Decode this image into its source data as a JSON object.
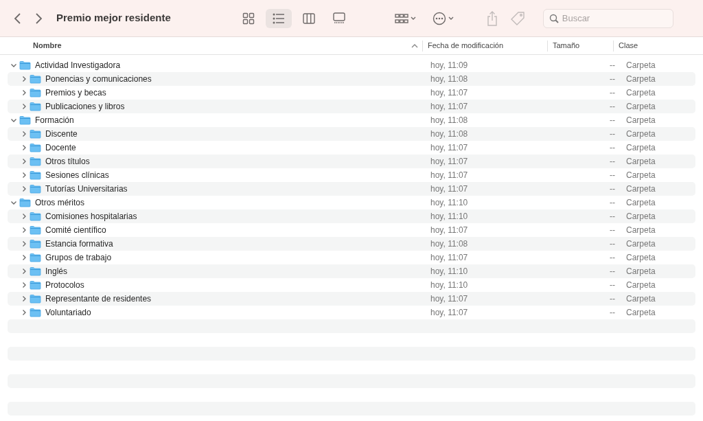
{
  "window": {
    "title": "Premio mejor residente"
  },
  "view_modes": [
    {
      "kind": "icons",
      "selected": false
    },
    {
      "kind": "list",
      "selected": true
    },
    {
      "kind": "columns",
      "selected": false
    },
    {
      "kind": "gallery",
      "selected": false
    }
  ],
  "search": {
    "placeholder": "Buscar"
  },
  "table": {
    "columns": [
      {
        "label": "Nombre",
        "sorted": true
      },
      {
        "label": "Fecha de modificación",
        "sorted": false
      },
      {
        "label": "Tamaño",
        "sorted": false
      },
      {
        "label": "Clase",
        "sorted": false
      }
    ],
    "rows": [
      {
        "name": "Actividad Investigadora",
        "date": "hoy, 11:09",
        "size": "--",
        "kind": "Carpeta",
        "expanded": true,
        "children": [
          {
            "name": "Ponencias y comunicaciones",
            "date": "hoy, 11:08",
            "size": "--",
            "kind": "Carpeta",
            "expanded": false
          },
          {
            "name": "Premios y becas",
            "date": "hoy, 11:07",
            "size": "--",
            "kind": "Carpeta",
            "expanded": false
          },
          {
            "name": "Publicaciones y libros",
            "date": "hoy, 11:07",
            "size": "--",
            "kind": "Carpeta",
            "expanded": false
          }
        ]
      },
      {
        "name": "Formación",
        "date": "hoy, 11:08",
        "size": "--",
        "kind": "Carpeta",
        "expanded": true,
        "children": [
          {
            "name": "Discente",
            "date": "hoy, 11:08",
            "size": "--",
            "kind": "Carpeta",
            "expanded": false
          },
          {
            "name": "Docente",
            "date": "hoy, 11:07",
            "size": "--",
            "kind": "Carpeta",
            "expanded": false
          },
          {
            "name": "Otros títulos",
            "date": "hoy, 11:07",
            "size": "--",
            "kind": "Carpeta",
            "expanded": false
          },
          {
            "name": "Sesiones clínicas",
            "date": "hoy, 11:07",
            "size": "--",
            "kind": "Carpeta",
            "expanded": false
          },
          {
            "name": "Tutorías Universitarias",
            "date": "hoy, 11:07",
            "size": "--",
            "kind": "Carpeta",
            "expanded": false
          }
        ]
      },
      {
        "name": "Otros méritos",
        "date": "hoy, 11:10",
        "size": "--",
        "kind": "Carpeta",
        "expanded": true,
        "children": [
          {
            "name": "Comisiones hospitalarias",
            "date": "hoy, 11:10",
            "size": "--",
            "kind": "Carpeta",
            "expanded": false
          },
          {
            "name": "Comité científico",
            "date": "hoy, 11:07",
            "size": "--",
            "kind": "Carpeta",
            "expanded": false
          },
          {
            "name": "Estancia formativa",
            "date": "hoy, 11:08",
            "size": "--",
            "kind": "Carpeta",
            "expanded": false
          },
          {
            "name": "Grupos de trabajo",
            "date": "hoy, 11:07",
            "size": "--",
            "kind": "Carpeta",
            "expanded": false
          },
          {
            "name": "Inglés",
            "date": "hoy, 11:10",
            "size": "--",
            "kind": "Carpeta",
            "expanded": false
          },
          {
            "name": "Protocolos",
            "date": "hoy, 11:10",
            "size": "--",
            "kind": "Carpeta",
            "expanded": false
          },
          {
            "name": "Representante de residentes",
            "date": "hoy, 11:07",
            "size": "--",
            "kind": "Carpeta",
            "expanded": false
          },
          {
            "name": "Voluntariado",
            "date": "hoy, 11:07",
            "size": "--",
            "kind": "Carpeta",
            "expanded": false
          }
        ]
      }
    ]
  }
}
